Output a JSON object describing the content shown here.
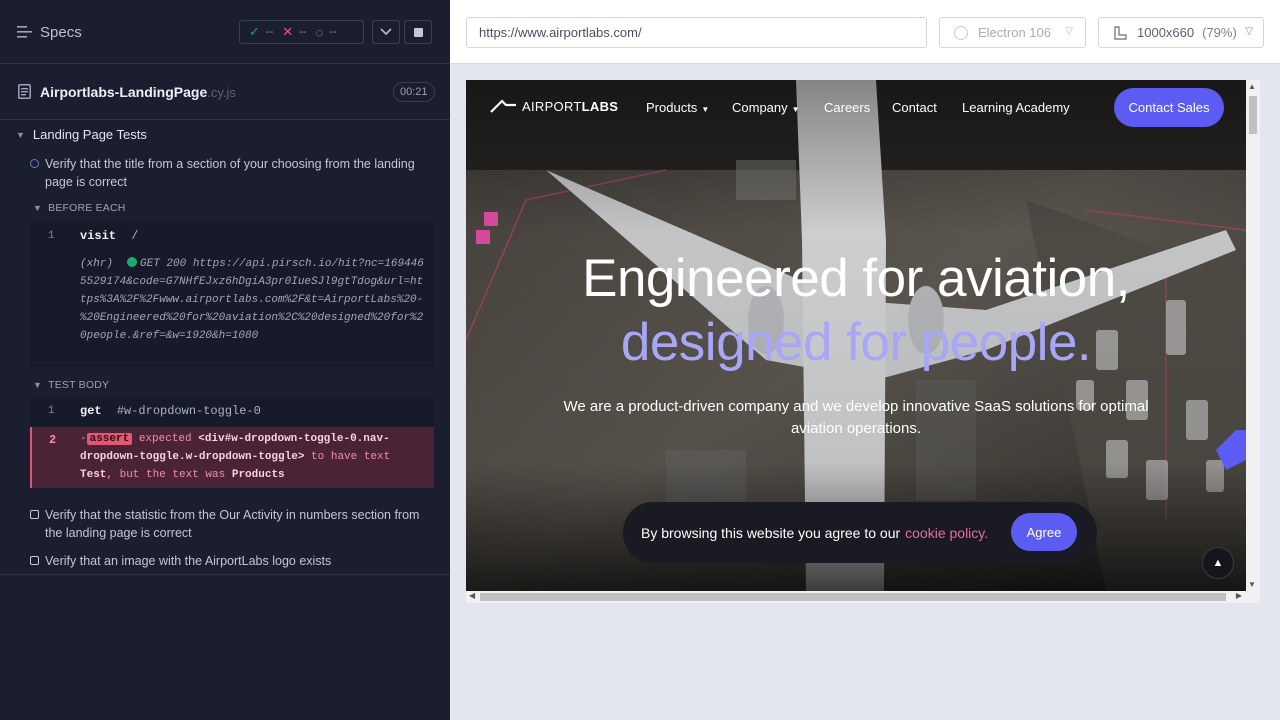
{
  "reporter": {
    "specs_label": "Specs",
    "stats": {
      "passed": "--",
      "failed": "--",
      "pending": "--"
    },
    "spec_file": {
      "name": "Airportlabs-LandingPage",
      "ext": ".cy.js",
      "duration": "00:21"
    },
    "suite": {
      "title": "Landing Page Tests",
      "tests": [
        {
          "title": "Verify that the title from a section of your choosing from the landing page is correct",
          "state": "running"
        },
        {
          "title": "Verify that the statistic from the Our Activity in numbers section from the landing page is correct",
          "state": "pending"
        },
        {
          "title": "Verify that an image with the AirportLabs logo exists",
          "state": "pending"
        }
      ]
    },
    "before_each": {
      "label": "BEFORE EACH",
      "command": {
        "num": "1",
        "name": "visit",
        "arg": "/"
      },
      "xhr": {
        "prefix": "(xhr)",
        "text": "GET 200 https://api.pirsch.io/hit?nc=1694465529174&code=G7NHfEJxz6hDgiA3pr0IueSJl9gtTdog&url=https%3A%2F%2Fwww.airportlabs.com%2F&t=AirportLabs%20-%20Engineered%20for%20aviation%2C%20designed%20for%20people.&ref=&w=1920&h=1080"
      }
    },
    "test_body": {
      "label": "TEST BODY",
      "command": {
        "num": "1",
        "name": "get",
        "arg": "#w-dropdown-toggle-0"
      },
      "assert": {
        "num": "2",
        "dash": "-",
        "badge": "assert",
        "expected_word": "expected",
        "selector": "<div#w-dropdown-toggle-0.nav-dropdown-toggle.w-dropdown-toggle>",
        "to_have": "to have text",
        "expected_text": "Test",
        "sep": ", but the text was",
        "actual_text": "Products"
      }
    }
  },
  "aut": {
    "url": "https://www.airportlabs.com/",
    "browser": "Electron 106",
    "viewport": "1000x660",
    "zoom": "(79%)"
  },
  "site": {
    "logo_text_1": "AIRPORT",
    "logo_text_2": "LABS",
    "nav": [
      "Products",
      "Company",
      "Careers",
      "Contact",
      "Learning Academy"
    ],
    "cta": "Contact Sales",
    "hero_line1": "Engineered for aviation,",
    "hero_line2": "designed for people.",
    "hero_sub": "We are a product-driven company and we develop innovative SaaS solutions for optimal aviation operations.",
    "cookie_text": "By browsing this website you agree to our",
    "cookie_link": "cookie policy.",
    "agree": "Agree",
    "accent": "#5d5cf2"
  }
}
